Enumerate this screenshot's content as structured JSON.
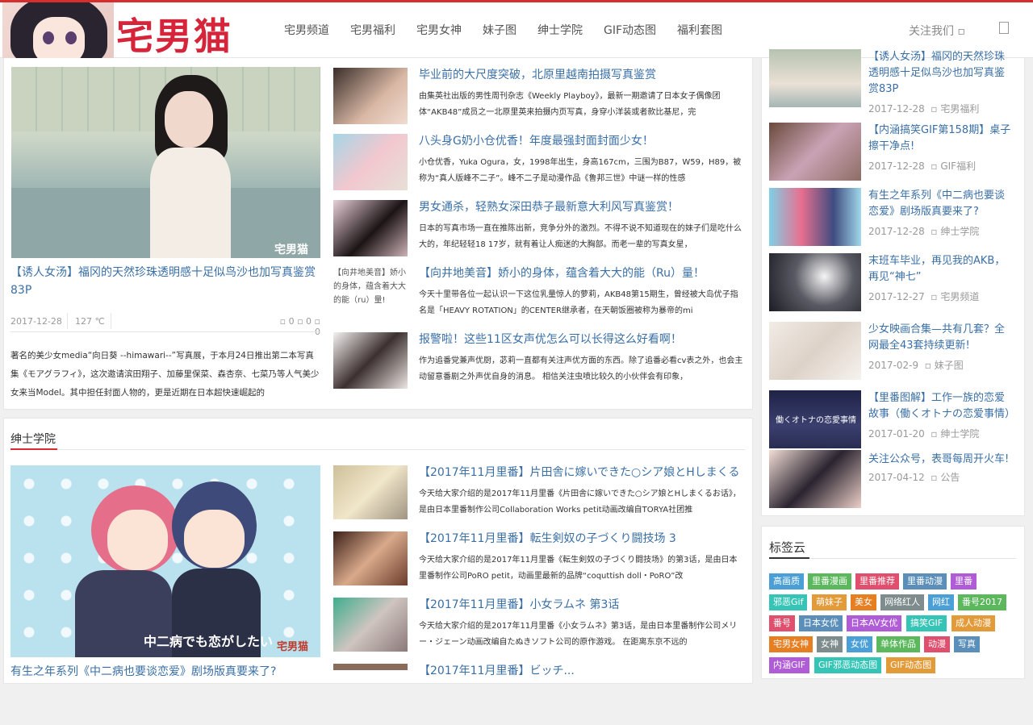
{
  "header": {
    "logo_text": "宅男猫",
    "nav": [
      "宅男频道",
      "宅男福利",
      "宅男女神",
      "妹子图",
      "绅士学院",
      "GIF动态图",
      "福利套图"
    ],
    "follow": "关注我们 ▫"
  },
  "featured": {
    "watermark": "宅男猫",
    "title": "【诱人女汤】福冈的天然珍珠透明感十足似鸟沙也加写真鉴赏83P",
    "date": "2017-12-28",
    "temp": "127 ℃",
    "stats": "▫ 0 ▫ 0 ▫ 0",
    "excerpt": "著名的美少女media“向日葵 --himawari--”写真展，于本月24日推出第二本写真集《モアグラフィ》，这次邀请滨田翔子、加藤里保菜、森杏奈、七菜乃等人气美少女来当Model。其中担任封面人物的，更是近期在日本超快速崛起的"
  },
  "articles": [
    {
      "title": "毕业前的大尺度突破，北原里越南拍摄写真鉴赏",
      "desc": "由集英社出版的男性周刊杂志《Weekly Playboy》，最新一期邀请了日本女子偶像团体“AKB48”成员之一北原里英来拍摄内页写真，身穿小洋装或者款比基尼，完"
    },
    {
      "title": "八头身G奶小仓优香！年度最强封面封面少女！",
      "desc": "小仓优香，Yuka Ogura，女，1998年出生，身高167cm，三围为B87，W59，H89，被称为“真人版峰不二子”。峰不二子是动漫作品《鲁邦三世》中谜一样的性感"
    },
    {
      "title": "男女通杀，轻熟女深田恭子最新意大利风写真鉴赏！",
      "desc": "日本的写真市场一直在推陈出新，竞争分外的激烈。不得不说不知道现在的妹子们是吃什么大的，年纪轻轻18 17岁，就有着让人痴迷的大胸部。而老一辈的写真女星，"
    },
    {
      "title": "【向井地美音】娇小的身体，蕴含着大大的能（Ru）量！",
      "desc": "今天十里带各位一起认识一下这位乳量惊人的萝莉，AKB48第15期生，曾经被大岛优子指名是「HEAVY ROTATION」的CENTER继承者，在天朝饭圈被称为暴帝的mi",
      "broken_img": "【向井地美音】娇小的身体，蕴含着大大的能（ru）量!"
    },
    {
      "title": "报警啦！这些11区女声优怎么可以长得这么好看啊！",
      "desc": "作为追番党兼声优厨，苾莉一直都有关注声优方面的东西。除了追番必看cv表之外，也会主动留意番剧之外声优自身的消息。 相信关注虫喷比较久的小伙伴会有印象，"
    }
  ],
  "section2": {
    "title": "绅士学院",
    "feature_caption": "有生之年系列《中二病也要谈恋爱》剧场版真要来了?",
    "feature_overlay": "中二病でも恋がしたい",
    "feature_watermark": "宅男猫",
    "articles": [
      {
        "title": "【2017年11月里番】片田舎に嫁いできた○シア娘とHしまくる",
        "desc": "今天给大家介绍的是2017年11月里番《片田舎に嫁いできた○シア娘とHしまくるお话》，是由日本里番制作公司Collaboration Works petit动画改编自TORYA社团推"
      },
      {
        "title": "【2017年11月里番】転生剣奴の子づくり闘技场 3",
        "desc": "今天给大家介绍的是2017年11月里番《転生剣奴の子づくり闘技场》的第3话，是由日本里番制作公司PoRO petit，动画里最新的品牌“coquttish doll・PoRO”改"
      },
      {
        "title": "【2017年11月里番】小女ラムネ 第3话",
        "desc": "今天给大家介绍的是2017年11月里番《小女ラムネ》第3话，是由日本里番制作公司メリー・ジェーン动画改编自たぬきソフト公司的原作游戏。 在距离东京不远的"
      },
      {
        "title": "【2017年11月里番】ビッチ...",
        "desc": ""
      }
    ]
  },
  "sidebar": {
    "items": [
      {
        "title": "【诱人女汤】福冈的天然珍珠透明感十足似鸟沙也加写真鉴赏83P",
        "date": "2017-12-28",
        "cat": "宅男福利"
      },
      {
        "title": "【内涵搞笑GIF第158期】桌子擦干净点!",
        "date": "2017-12-28",
        "cat": "GIF福利"
      },
      {
        "title": "有生之年系列《中二病也要谈恋爱》剧场版真要来了?",
        "date": "2017-12-28",
        "cat": "绅士学院"
      },
      {
        "title": "末班车毕业，再见我的AKB，再见“神七”",
        "date": "2017-12-27",
        "cat": "宅男频道"
      },
      {
        "title": "少女映画合集—共有几套？全网最全43套持续更新!",
        "date": "2017-02-9",
        "cat": "妹子图"
      },
      {
        "title": "【里番图解】工作一族的恋爱故事（働くオトナの恋爱事情）",
        "date": "2017-01-20",
        "cat": "绅士学院",
        "overlay": "働くオトナの恋愛事情"
      },
      {
        "title": "关注公众号，表哥每周开火车!",
        "date": "2017-04-12",
        "cat": "公告"
      }
    ],
    "tag_title": "标签云",
    "tags": [
      {
        "label": "高画质",
        "color": "#4a9fd6"
      },
      {
        "label": "里番漫画",
        "color": "#5cb85c"
      },
      {
        "label": "里番推荐",
        "color": "#e0506e"
      },
      {
        "label": "里番动漫",
        "color": "#5b8fb9"
      },
      {
        "label": "里番",
        "color": "#b05cd6"
      },
      {
        "label": "邪恶Gif",
        "color": "#35c4b5"
      },
      {
        "label": "萌妹子",
        "color": "#e39b3a"
      },
      {
        "label": "美女",
        "color": "#e67e22"
      },
      {
        "label": "网络红人",
        "color": "#7f8c8d"
      },
      {
        "label": "网红",
        "color": "#4a9fd6"
      },
      {
        "label": "番号2017",
        "color": "#5cb85c"
      },
      {
        "label": "番号",
        "color": "#e0506e"
      },
      {
        "label": "日本女优",
        "color": "#5b8fb9"
      },
      {
        "label": "日本AV女优",
        "color": "#b05cd6"
      },
      {
        "label": "搞笑GIF",
        "color": "#35c4b5"
      },
      {
        "label": "成人动漫",
        "color": "#e39b3a"
      },
      {
        "label": "宅男女神",
        "color": "#e67e22"
      },
      {
        "label": "女神",
        "color": "#7f8c8d"
      },
      {
        "label": "女优",
        "color": "#4a9fd6"
      },
      {
        "label": "单体作品",
        "color": "#5cb85c"
      },
      {
        "label": "动漫",
        "color": "#e0506e"
      },
      {
        "label": "写真",
        "color": "#5b8fb9"
      },
      {
        "label": "内涵GIF",
        "color": "#b05cd6"
      },
      {
        "label": "GIF邪恶动态图",
        "color": "#35c4b5"
      },
      {
        "label": "GIF动态图",
        "color": "#e39b3a"
      }
    ]
  }
}
